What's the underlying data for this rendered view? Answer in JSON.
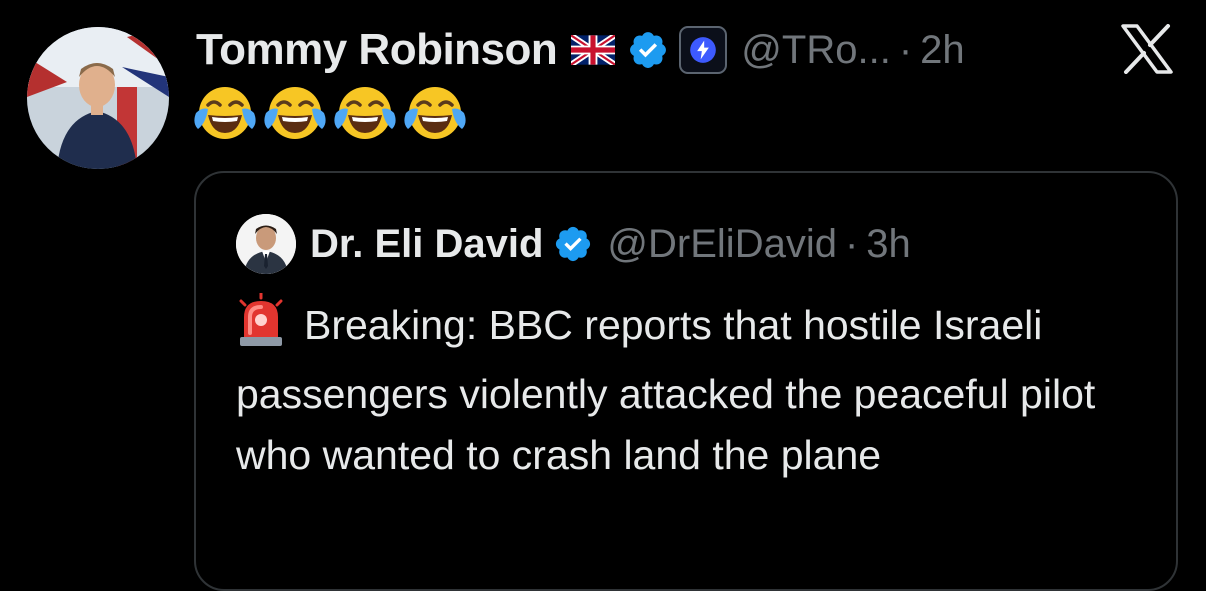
{
  "tweet": {
    "author": {
      "display_name": "Tommy Robinson",
      "handle": "@TRo...",
      "time": "2h",
      "separator": "·",
      "badges": [
        "uk-flag-icon",
        "verified-icon",
        "affiliate-bolt-icon"
      ]
    },
    "text_emojis": [
      "face-with-tears-of-joy",
      "face-with-tears-of-joy",
      "face-with-tears-of-joy",
      "face-with-tears-of-joy"
    ],
    "platform_logo": "x-logo-icon"
  },
  "quote": {
    "author": {
      "display_name": "Dr. Eli David",
      "handle": "@DrEliDavid",
      "time": "3h",
      "separator": "·"
    },
    "leading_icon": "police-siren-icon",
    "text": "Breaking: BBC reports that hostile Israeli passengers violently attacked the peaceful pilot who wanted to crash land the plane"
  },
  "colors": {
    "background": "#000000",
    "primary_text": "#e7e9ea",
    "secondary_text": "#71767b",
    "verified_blue": "#1d9bf0",
    "card_border": "#2f3336"
  }
}
